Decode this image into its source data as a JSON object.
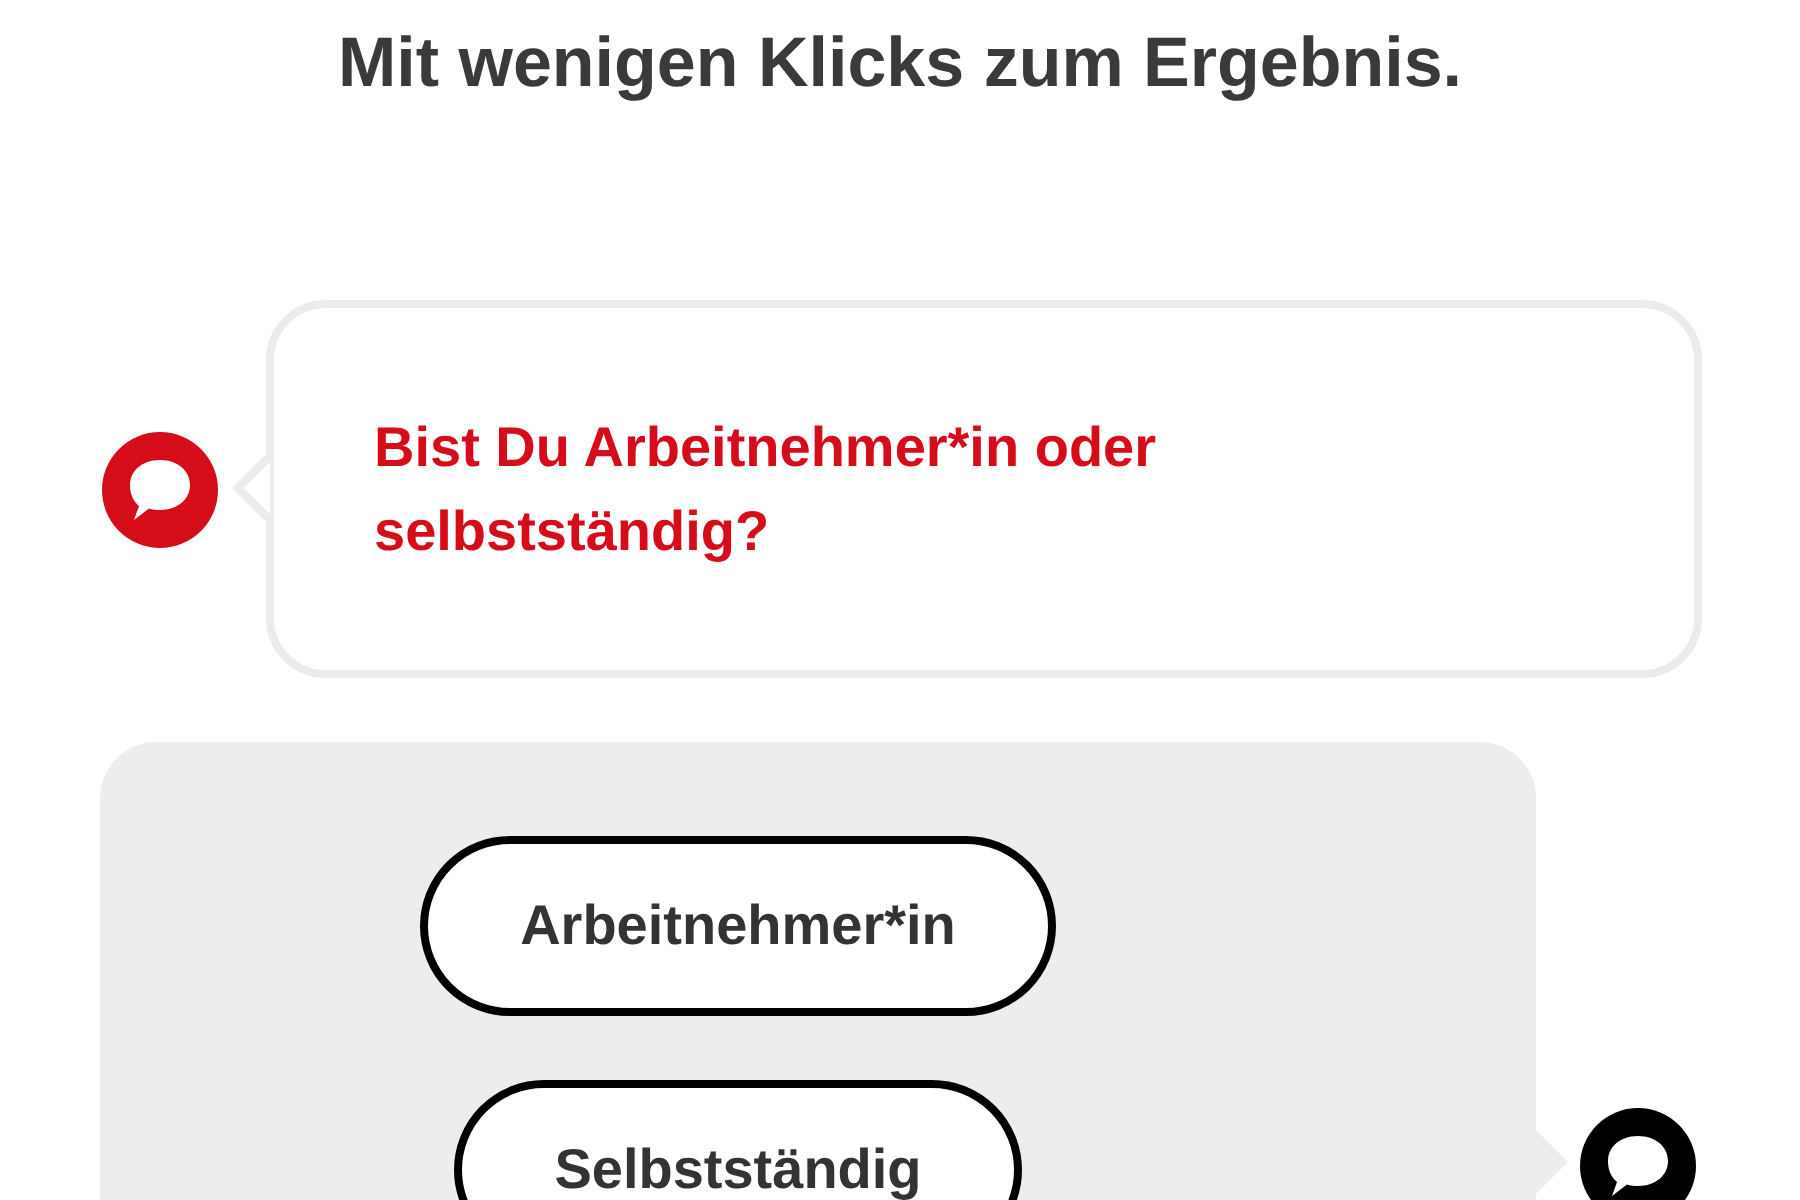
{
  "heading": "Mit wenigen Klicks zum Ergebnis.",
  "question": {
    "text": "Bist Du Arbeitnehmer*in oder selbstständig?"
  },
  "answers": [
    {
      "label": "Arbeitnehmer*in"
    },
    {
      "label": "Selbstständig"
    }
  ]
}
